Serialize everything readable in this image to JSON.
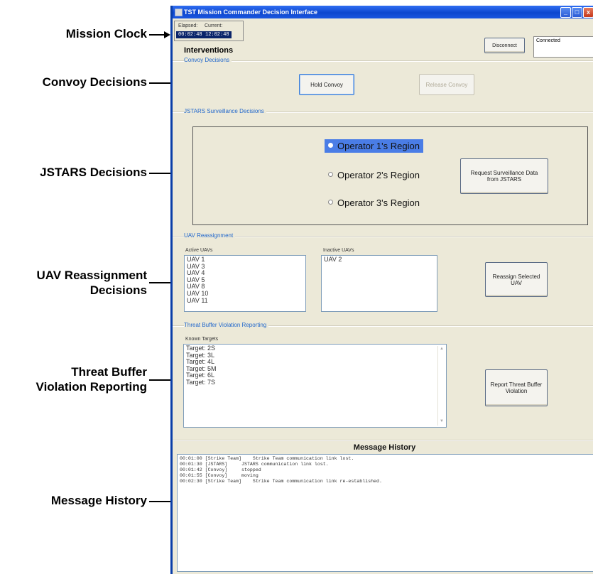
{
  "callouts": {
    "mission_clock": "Mission Clock",
    "convoy": "Convoy Decisions",
    "jstars": "JSTARS Decisions",
    "uav_line1": "UAV Reassignment",
    "uav_line2": "Decisions",
    "threat_line1": "Threat Buffer",
    "threat_line2": "Violation Reporting",
    "message": "Message History"
  },
  "window": {
    "title": "TST Mission Commander Decision Interface",
    "minimize": "_",
    "maximize": "□",
    "close": "x"
  },
  "clock": {
    "elapsed_label": "Elapsed:",
    "current_label": "Current:",
    "elapsed_value": "00:02:48",
    "current_value": "12:02:48"
  },
  "connection": {
    "disconnect_label": "Disconnect",
    "status": "Connected"
  },
  "interventions": {
    "title": "Interventions",
    "convoy_group": "Convoy Decisions",
    "hold_convoy": "Hold Convoy",
    "release_convoy": "Release Convoy"
  },
  "jstars": {
    "group": "JSTARS Surveillance Decisions",
    "regions": [
      "Operator 1's Region",
      "Operator 2's Region",
      "Operator 3's Region"
    ],
    "selected_region": "Operator 1's Region",
    "request_button": "Request Surveillance Data from JSTARS"
  },
  "uav": {
    "group": "UAV Reassignment",
    "active_label": "Active UAVs",
    "active": [
      "UAV 1",
      "UAV 3",
      "UAV 4",
      "UAV 5",
      "UAV 8",
      "UAV 10",
      "UAV 11"
    ],
    "inactive_label": "Inactive UAVs",
    "inactive": [
      "UAV 2"
    ],
    "reassign_button": "Reassign Selected UAV"
  },
  "threat": {
    "group": "Threat Buffer Violation Reporting",
    "known_label": "Known Targets",
    "targets": [
      "Target: 2S",
      "Target: 3L",
      "Target: 4L",
      "Target: 5M",
      "Target: 6L",
      "Target: 7S"
    ],
    "report_button": "Report Threat Buffer Violation"
  },
  "message_history": {
    "title": "Message History",
    "lines": [
      "00:01:00 [Strike Team]    Strike Team communication link lost.",
      "00:01:30 [JSTARS]     JSTARS communication link lost.",
      "00:01:42 [Convoy]     stopped",
      "00:01:55 [Convoy]     moving",
      "00:02:30 [Strike Team]    Strike Team communication link re-established."
    ]
  },
  "colors": {
    "accent": "#1f66cc",
    "selection": "#4a7de6",
    "titlebar": "#0d47cf"
  }
}
